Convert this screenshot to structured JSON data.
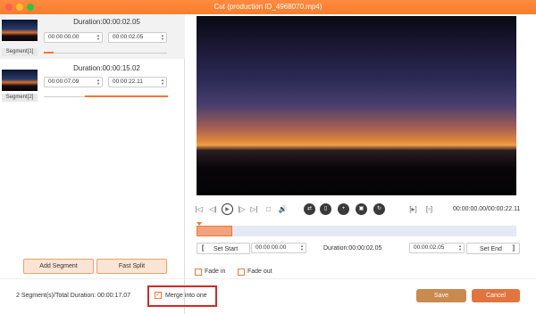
{
  "window": {
    "title": "Cut (production ID_4968070.mp4)"
  },
  "segments": [
    {
      "label": "Segment[1]",
      "duration": "Duration:00:00:02.05",
      "start": "00:00:00.00",
      "end": "00:00:02.05",
      "progress": 0.08
    },
    {
      "label": "Segment[2]",
      "duration": "Duration:00:00:15.02",
      "start": "00:00:07.09",
      "end": "00:00:22.11",
      "progress": 0.68
    }
  ],
  "left_buttons": {
    "add_segment": "Add Segment",
    "fast_split": "Fast Split"
  },
  "player": {
    "time_display": "00:00:00.00/00:00:22.11"
  },
  "trim": {
    "set_start": "Set Start",
    "start_value": "00:00:00.00",
    "duration": "Duration:00:00:02.05",
    "end_value": "00:00:02.05",
    "set_end": "Set End"
  },
  "fades": {
    "fade_in": "Fade in",
    "fade_out": "Fade out"
  },
  "footer": {
    "summary": "2 Segment(s)/Total Duration: 00:00:17.07",
    "merge_label": "Merge into one",
    "merge_checked": true,
    "save": "Save",
    "cancel": "Cancel"
  },
  "icons": {
    "close": "close-icon",
    "up": "chevron-up-icon",
    "down": "chevron-down-icon"
  },
  "colors": {
    "accent": "#f37735",
    "highlight": "#d42828",
    "save": "#c98a4e",
    "cancel": "#e2753f"
  }
}
